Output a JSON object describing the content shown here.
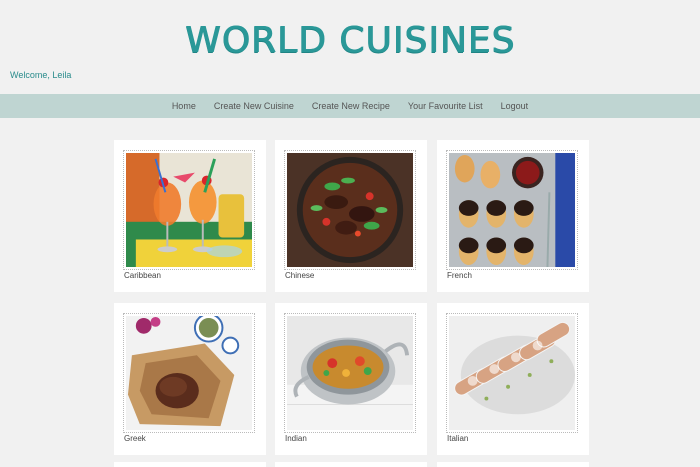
{
  "header": {
    "title": "WORLD CUISINES",
    "welcome": "Welcome, Leila"
  },
  "nav": {
    "items": [
      "Home",
      "Create New Cuisine",
      "Create New Recipe",
      "Your Favourite List",
      "Logout"
    ]
  },
  "cuisines": [
    "Caribbean",
    "Chinese",
    "French",
    "Greek",
    "Indian",
    "Italian"
  ],
  "colors": {
    "title": "#2a9898",
    "navbar": "#bfd5d2",
    "background": "#f1f1f1"
  }
}
